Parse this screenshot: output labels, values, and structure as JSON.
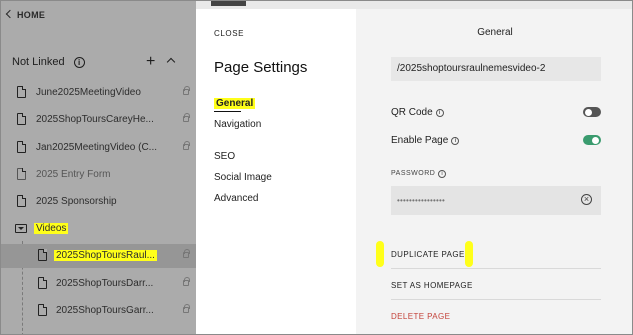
{
  "sidebar": {
    "home_label": "HOME",
    "section_title": "Not Linked",
    "items": [
      {
        "label": "June2025MeetingVideo"
      },
      {
        "label": "2025ShopToursCareyHe..."
      },
      {
        "label": "Jan2025MeetingVideo (C..."
      },
      {
        "label": "2025 Entry Form"
      },
      {
        "label": "2025 Sponsorship"
      }
    ],
    "folder_label": "Videos",
    "children": [
      {
        "label": "2025ShopToursRaul..."
      },
      {
        "label": "2025ShopToursDarr..."
      },
      {
        "label": "2025ShopToursGarr..."
      }
    ]
  },
  "page_settings": {
    "close_label": "CLOSE",
    "title": "Page Settings",
    "menu": [
      "General",
      "Navigation",
      "SEO",
      "Social Image",
      "Advanced"
    ]
  },
  "general": {
    "title": "General",
    "url_slug": "/2025shoptoursraulnemesvideo-2",
    "qr_code_label": "QR Code",
    "qr_code_enabled": false,
    "enable_page_label": "Enable Page",
    "enable_page_enabled": true,
    "password_label": "PASSWORD",
    "password_value": "••••••••••••••••",
    "duplicate_label": "DUPLICATE PAGE",
    "homepage_label": "SET AS HOMEPAGE",
    "delete_label": "DELETE PAGE"
  },
  "colors": {
    "highlight": "#ffff1a",
    "toggle_on": "#3a9b6e",
    "danger": "#c4433b"
  }
}
